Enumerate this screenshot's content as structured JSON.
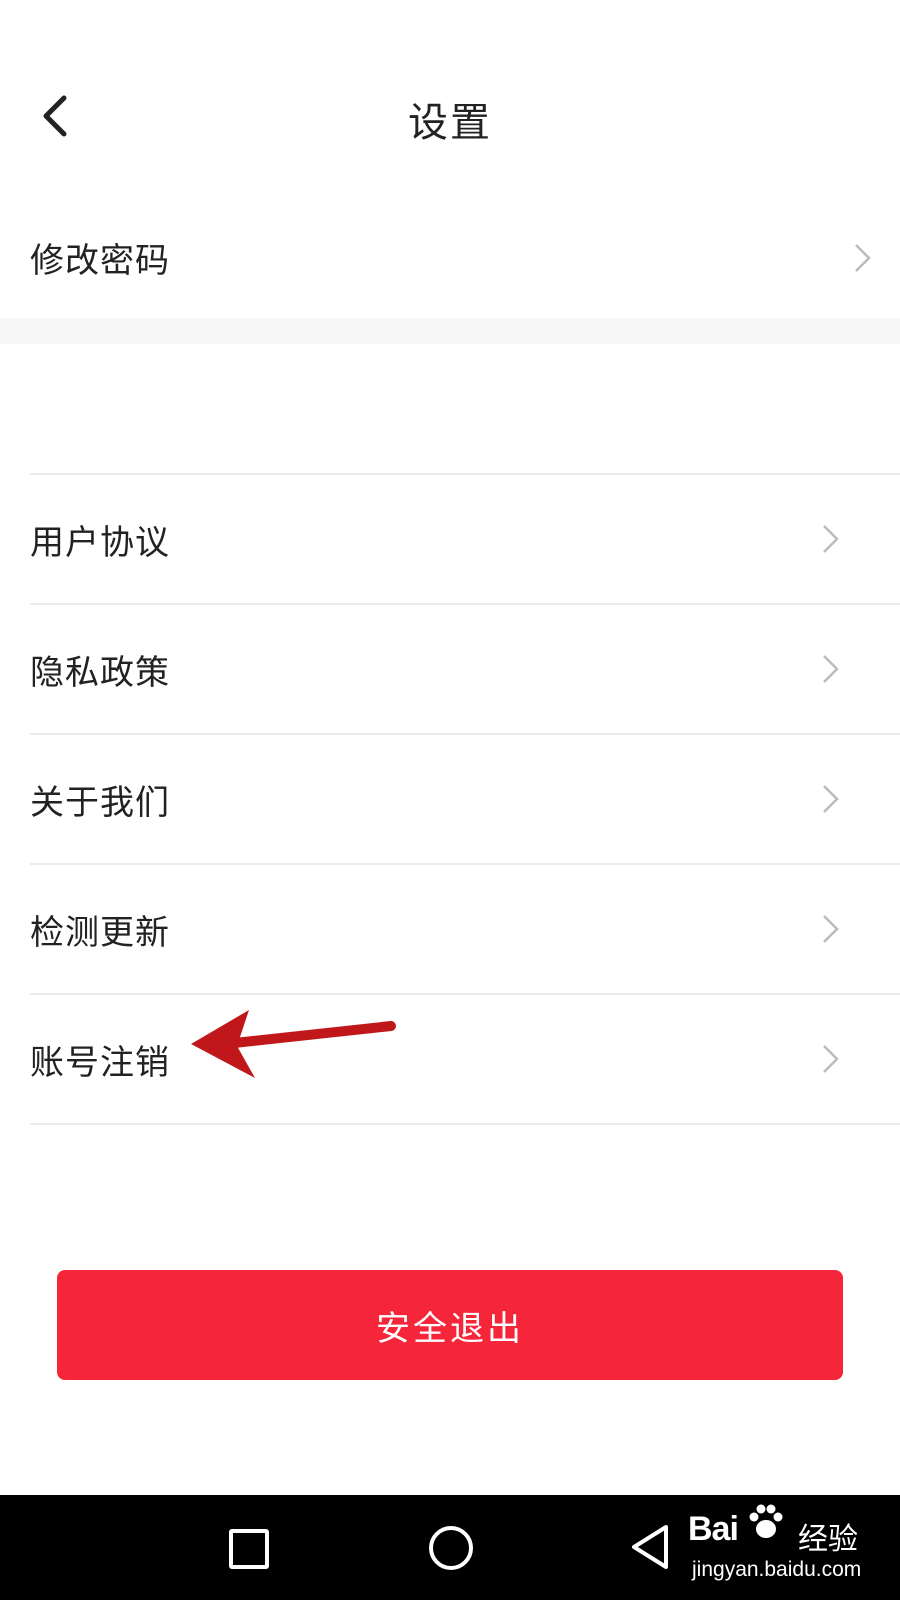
{
  "header": {
    "title": "设置",
    "back_icon": "chevron-left-icon"
  },
  "top_item": {
    "label": "修改密码"
  },
  "items": [
    {
      "label": "用户协议"
    },
    {
      "label": "隐私政策"
    },
    {
      "label": "关于我们"
    },
    {
      "label": "检测更新"
    },
    {
      "label": "账号注销"
    }
  ],
  "logout": {
    "label": "安全退出"
  },
  "colors": {
    "accent": "#f5253a",
    "annotation": "#c0181a",
    "divider": "#ececec",
    "text": "#222222",
    "chevron": "#bbbbbb"
  },
  "navbar": {
    "icons": [
      "square-icon",
      "circle-icon",
      "triangle-back-icon"
    ]
  },
  "watermark": {
    "brand": "Bai",
    "brand_cn": "经验",
    "url": "jingyan.baidu.com"
  }
}
